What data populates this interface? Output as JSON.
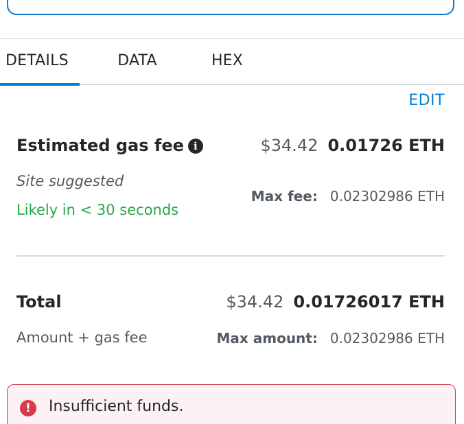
{
  "tabs": {
    "details": "DETAILS",
    "data": "DATA",
    "hex": "HEX"
  },
  "edit_label": "EDIT",
  "gas_fee": {
    "title": "Estimated gas fee",
    "info_icon": "i",
    "fiat": "$34.42",
    "crypto": "0.01726 ETH",
    "site_suggested": "Site suggested",
    "likely": "Likely in < 30 seconds",
    "max_fee_label": "Max fee:",
    "max_fee_value": "0.02302986 ETH"
  },
  "total": {
    "title": "Total",
    "fiat": "$34.42",
    "crypto": "0.01726017 ETH",
    "subtitle": "Amount + gas fee",
    "max_amount_label": "Max amount:",
    "max_amount_value": "0.02302986 ETH"
  },
  "error": {
    "icon": "!",
    "message": "Insufficient funds."
  },
  "colors": {
    "accent": "#037dd6",
    "success": "#28a745",
    "error": "#d73a49"
  }
}
